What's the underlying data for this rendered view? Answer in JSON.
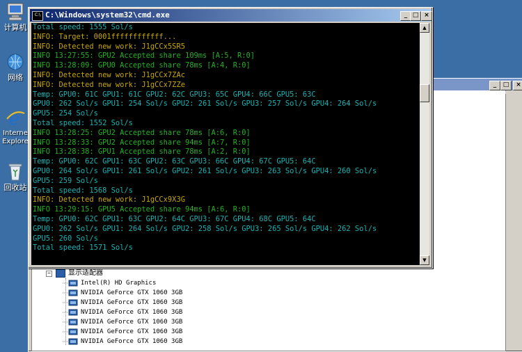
{
  "desktop": {
    "icons": [
      {
        "label": "计算机"
      },
      {
        "label": "网络"
      },
      {
        "label": "Internet Explorer",
        "short": "Interne\nExplore"
      },
      {
        "label": "回收站"
      }
    ]
  },
  "cmd_window": {
    "title": "C:\\Windows\\system32\\cmd.exe",
    "icon_text": "C:\\",
    "buttons": {
      "minimize": "_",
      "maximize": "□",
      "close": "×"
    },
    "lines": [
      {
        "text": "Total speed: 1555 Sol/s",
        "color": "cyan"
      },
      {
        "text": "INFO: Target: 0001ffffffffffff...",
        "color": "yellow"
      },
      {
        "text": "INFO: Detected new work: J1gCCx5SR5",
        "color": "yellow"
      },
      {
        "text": "INFO 13:27:55: GPU2 Accepted share 109ms [A:5, R:0]",
        "color": "green"
      },
      {
        "text": "INFO 13:28:09: GPU0 Accepted share 78ms [A:4, R:0]",
        "color": "green"
      },
      {
        "text": "INFO: Detected new work: J1gCCx7ZAc",
        "color": "yellow"
      },
      {
        "text": "INFO: Detected new work: J1gCCx7ZZe",
        "color": "yellow"
      },
      {
        "text": "Temp: GPU0: 61C GPU1: 61C GPU2: 62C GPU3: 65C GPU4: 66C GPU5: 63C",
        "color": "cyan"
      },
      {
        "text": "GPU0: 262 Sol/s GPU1: 254 Sol/s GPU2: 261 Sol/s GPU3: 257 Sol/s GPU4: 264 Sol/s",
        "color": "cyan"
      },
      {
        "text": "GPU5: 254 Sol/s",
        "color": "cyan"
      },
      {
        "text": "Total speed: 1552 Sol/s",
        "color": "cyan"
      },
      {
        "text": "INFO 13:28:25: GPU2 Accepted share 78ms [A:6, R:0]",
        "color": "green"
      },
      {
        "text": "INFO 13:28:33: GPU2 Accepted share 94ms [A:7, R:0]",
        "color": "green"
      },
      {
        "text": "INFO 13:28:38: GPU1 Accepted share 78ms [A:2, R:0]",
        "color": "green"
      },
      {
        "text": "Temp: GPU0: 62C GPU1: 63C GPU2: 63C GPU3: 66C GPU4: 67C GPU5: 64C",
        "color": "cyan"
      },
      {
        "text": "GPU0: 264 Sol/s GPU1: 261 Sol/s GPU2: 261 Sol/s GPU3: 263 Sol/s GPU4: 260 Sol/s",
        "color": "cyan"
      },
      {
        "text": "GPU5: 259 Sol/s",
        "color": "cyan"
      },
      {
        "text": "Total speed: 1568 Sol/s",
        "color": "cyan"
      },
      {
        "text": "INFO: Detected new work: J1gCCx9X3G",
        "color": "yellow"
      },
      {
        "text": "INFO 13:29:15: GPU5 Accepted share 94ms [A:6, R:0]",
        "color": "green"
      },
      {
        "text": "Temp: GPU0: 62C GPU1: 63C GPU2: 64C GPU3: 67C GPU4: 68C GPU5: 64C",
        "color": "cyan"
      },
      {
        "text": "GPU0: 262 Sol/s GPU1: 264 Sol/s GPU2: 258 Sol/s GPU3: 265 Sol/s GPU4: 262 Sol/s",
        "color": "cyan"
      },
      {
        "text": "GPU5: 260 Sol/s",
        "color": "cyan"
      },
      {
        "text": "Total speed: 1571 Sol/s",
        "color": "cyan"
      }
    ],
    "scrollbar_position": 0.25
  },
  "device_manager": {
    "category": {
      "toggle": "−",
      "label": "显示适配器"
    },
    "devices": [
      "Intel(R) HD Graphics",
      "NVIDIA GeForce GTX 1060 3GB",
      "NVIDIA GeForce GTX 1060 3GB",
      "NVIDIA GeForce GTX 1060 3GB",
      "NVIDIA GeForce GTX 1060 3GB",
      "NVIDIA GeForce GTX 1060 3GB",
      "NVIDIA GeForce GTX 1060 3GB"
    ]
  },
  "colors": {
    "desktop": "#3a6ea5",
    "cyan": "#1ab3b3",
    "yellow": "#c8a800",
    "green": "#22b222"
  }
}
